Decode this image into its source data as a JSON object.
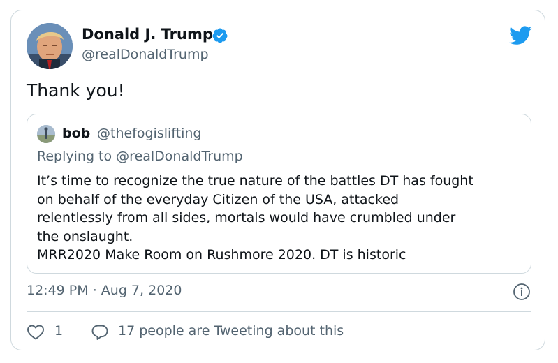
{
  "author": {
    "name": "Donald J. Trump",
    "handle": "@realDonaldTrump",
    "verified": true,
    "avatar_icon": "profile-photo"
  },
  "tweet": {
    "text": "Thank you!",
    "time": "12:49 PM",
    "separator": "·",
    "date": "Aug 7, 2020"
  },
  "quoted": {
    "name": "bob",
    "handle": "@thefogislifting",
    "reply_prefix": "Replying to",
    "reply_to": "@realDonaldTrump",
    "lines": [
      "It’s time to recognize the true nature of the battles DT has fought",
      "on behalf of the everyday Citizen of the USA, attacked",
      "relentlessly from all sides, mortals would have crumbled under",
      "the onslaught.",
      "MRR2020 Make Room on Rushmore 2020. DT is historic"
    ]
  },
  "engagement": {
    "likes": "1",
    "tweeting_text": "17 people are Tweeting about this"
  },
  "icons": {
    "verified": "verified-badge-icon",
    "brand": "twitter-bird-icon",
    "info": "info-icon",
    "like": "heart-icon",
    "reply": "speech-bubble-icon"
  },
  "colors": {
    "twitter_blue": "#1d9bf0",
    "secondary_text": "#536471",
    "border": "#cfd9de"
  }
}
